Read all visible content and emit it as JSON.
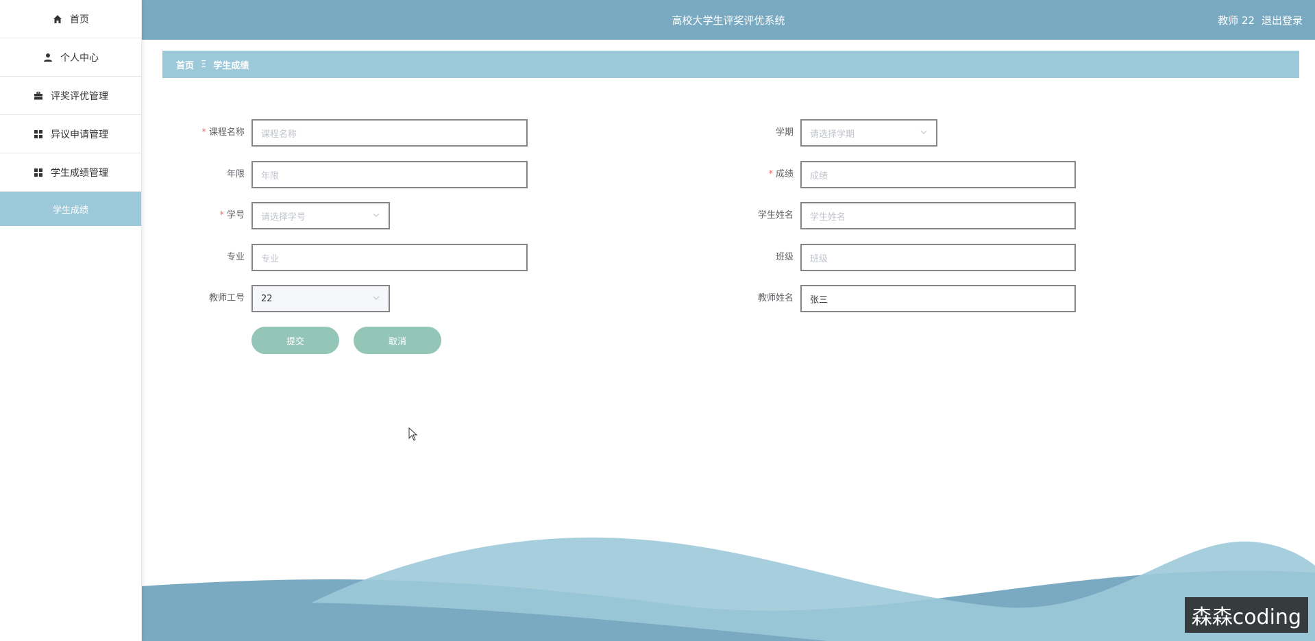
{
  "sidebar": {
    "items": [
      {
        "label": "首页",
        "icon": "home-icon"
      },
      {
        "label": "个人中心",
        "icon": "user-icon"
      },
      {
        "label": "评奖评优管理",
        "icon": "briefcase-icon"
      },
      {
        "label": "异议申请管理",
        "icon": "grid-icon"
      },
      {
        "label": "学生成绩管理",
        "icon": "grid-icon"
      }
    ],
    "sub_active": "学生成绩"
  },
  "header": {
    "title": "高校大学生评奖评优系统",
    "user": "教师 22",
    "logout": "退出登录"
  },
  "breadcrumb": {
    "home": "首页",
    "separator": "Ξ",
    "current": "学生成绩"
  },
  "form": {
    "course_name": {
      "label": "课程名称",
      "placeholder": "课程名称",
      "required": true
    },
    "term": {
      "label": "学期",
      "placeholder": "请选择学期"
    },
    "years": {
      "label": "年限",
      "placeholder": "年限"
    },
    "score": {
      "label": "成绩",
      "placeholder": "成绩",
      "required": true
    },
    "student_id": {
      "label": "学号",
      "placeholder": "请选择学号",
      "required": true
    },
    "student_name": {
      "label": "学生姓名",
      "placeholder": "学生姓名"
    },
    "major": {
      "label": "专业",
      "placeholder": "专业"
    },
    "class": {
      "label": "班级",
      "placeholder": "班级"
    },
    "teacher_id": {
      "label": "教师工号",
      "value": "22"
    },
    "teacher_name": {
      "label": "教师姓名",
      "value": "张三"
    },
    "required_mark": "*",
    "submit": "提交",
    "cancel": "取消"
  },
  "watermark": "森森coding",
  "colors": {
    "header": "#7aaac2",
    "breadcrumb": "#9cc9d9",
    "button": "#94c6b8",
    "required": "#f56c6c"
  }
}
